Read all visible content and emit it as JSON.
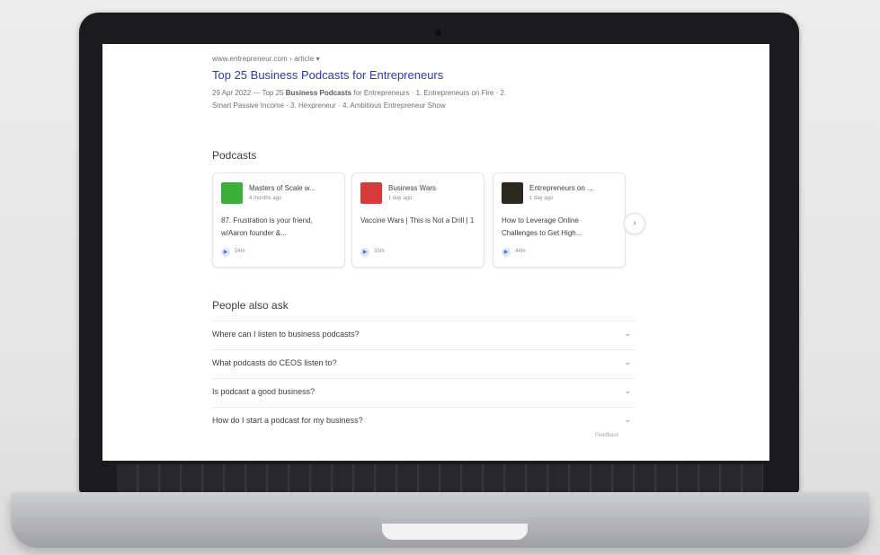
{
  "result": {
    "url": "www.entrepreneur.com › article ▾",
    "title": "Top 25 Business Podcasts for Entrepreneurs",
    "snippet_line1_pre": "29 Apr 2022 — Top 25 ",
    "snippet_line1_bold": "Business Podcasts",
    "snippet_line1_post": " for Entrepreneurs · 1. Entrepreneurs on Fire · 2.",
    "snippet_line2": "Smart Passive Income · 3. Hexpreneur · 4. Ambitious Entrepreneur Show"
  },
  "podcasts": {
    "heading": "Podcasts",
    "next_icon": "chevron-right-icon",
    "cards": [
      {
        "name": "Masters of Scale w...",
        "age": "4 months ago",
        "episode": "87. Frustration is your friend, w/Aaron founder &...",
        "duration": "54m",
        "thumb_color": "#3cae3a"
      },
      {
        "name": "Business Wars",
        "age": "1 day ago",
        "episode": "Vaccine Wars | This is Not a Drill | 1",
        "duration": "33m",
        "thumb_color": "#d83b3b"
      },
      {
        "name": "Entrepreneurs on ...",
        "age": "1 day ago",
        "episode": "How to Leverage Online Challenges to Get High...",
        "duration": "44m",
        "thumb_color": "#2c2a20"
      }
    ]
  },
  "people_also_ask": {
    "heading": "People also ask",
    "questions": [
      "Where can I listen to business podcasts?",
      "What podcasts do CEOS listen to?",
      "Is podcast a good business?",
      "How do I start a podcast for my business?"
    ],
    "chevron": "⌄",
    "feedback": "Feedback"
  }
}
